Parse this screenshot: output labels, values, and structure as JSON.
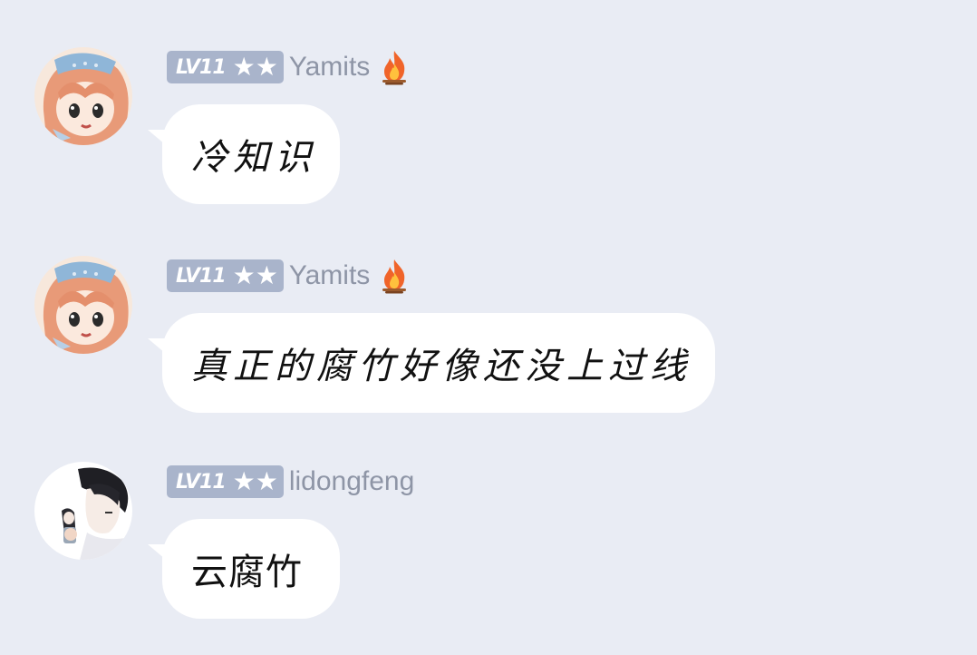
{
  "messages": [
    {
      "user": {
        "level": "LV11",
        "stars": "★★",
        "name": "Yamits",
        "badge_icon": "fire-emoji"
      },
      "avatar": "anime-girl-orange-hair",
      "text": "冷知识"
    },
    {
      "user": {
        "level": "LV11",
        "stars": "★★",
        "name": "Yamits",
        "badge_icon": "fire-emoji"
      },
      "avatar": "anime-girl-orange-hair",
      "text": "真正的腐竹好像还没上过线"
    },
    {
      "user": {
        "level": "LV11",
        "stars": "★★",
        "name": "lidongfeng",
        "badge_icon": ""
      },
      "avatar": "anime-boy-dark-hair",
      "text": "云腐竹"
    }
  ],
  "colors": {
    "background": "#e9ecf4",
    "bubble": "#ffffff",
    "badge": "#a9b4cb",
    "username": "#8e95a6"
  }
}
